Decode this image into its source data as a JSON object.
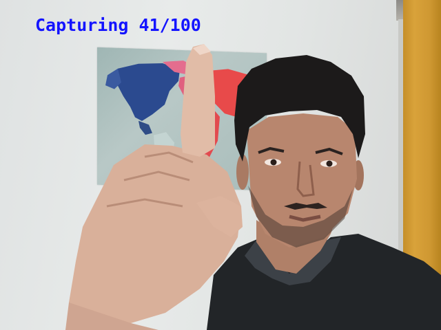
{
  "overlay": {
    "status_label": "Capturing",
    "progress_text": "41/100",
    "current": 41,
    "total": 100,
    "text_color": "#1414ff"
  },
  "scene": {
    "icons": [
      "world-map-poster",
      "raised-index-finger-hand",
      "person"
    ]
  }
}
